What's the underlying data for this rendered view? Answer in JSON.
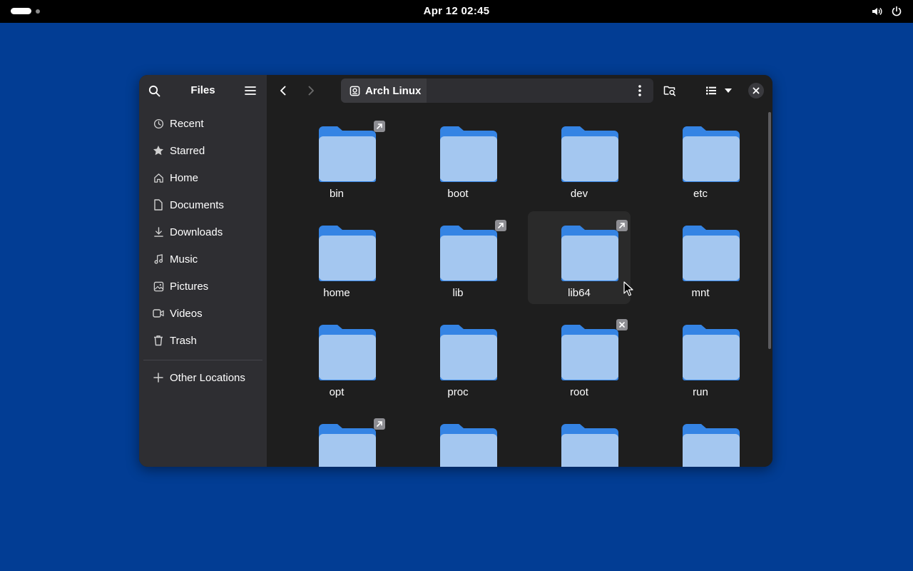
{
  "topbar": {
    "clock": "Apr 12  02:45",
    "icons": [
      "activities-indicator",
      "volume-icon",
      "power-icon"
    ]
  },
  "window": {
    "sidebar": {
      "title": "Files",
      "items": [
        {
          "label": "Recent",
          "icon": "clock-icon"
        },
        {
          "label": "Starred",
          "icon": "star-icon"
        },
        {
          "label": "Home",
          "icon": "home-icon"
        },
        {
          "label": "Documents",
          "icon": "document-icon"
        },
        {
          "label": "Downloads",
          "icon": "download-icon"
        },
        {
          "label": "Music",
          "icon": "music-icon"
        },
        {
          "label": "Pictures",
          "icon": "picture-icon"
        },
        {
          "label": "Videos",
          "icon": "video-icon"
        },
        {
          "label": "Trash",
          "icon": "trash-icon"
        }
      ],
      "other_locations": "Other Locations"
    },
    "path": {
      "location": "Arch Linux"
    },
    "folders": [
      {
        "name": "bin",
        "emblem": "symlink"
      },
      {
        "name": "boot",
        "emblem": ""
      },
      {
        "name": "dev",
        "emblem": ""
      },
      {
        "name": "etc",
        "emblem": ""
      },
      {
        "name": "home",
        "emblem": ""
      },
      {
        "name": "lib",
        "emblem": "symlink"
      },
      {
        "name": "lib64",
        "emblem": "symlink",
        "hovered": true
      },
      {
        "name": "mnt",
        "emblem": ""
      },
      {
        "name": "opt",
        "emblem": ""
      },
      {
        "name": "proc",
        "emblem": ""
      },
      {
        "name": "root",
        "emblem": "unreadable"
      },
      {
        "name": "run",
        "emblem": ""
      },
      {
        "name": "",
        "emblem": "symlink"
      },
      {
        "name": "",
        "emblem": ""
      },
      {
        "name": "",
        "emblem": ""
      },
      {
        "name": "",
        "emblem": ""
      }
    ],
    "colors": {
      "folder_back": "#3584e4",
      "folder_front": "#a4c7f0",
      "sidebar_bg": "#2e2e32",
      "content_bg": "#1e1e1e",
      "desktop_bg": "#023d94"
    }
  }
}
